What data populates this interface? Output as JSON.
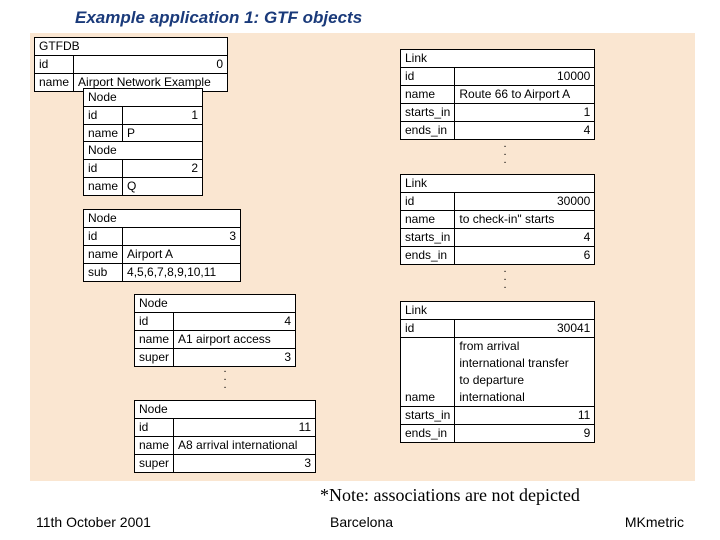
{
  "title": "Example application 1: GTF objects",
  "note": "*Note: associations are not depicted",
  "footer": {
    "left": "11th October 2001",
    "center": "Barcelona",
    "right": "MKmetric"
  },
  "labels": {
    "gtfdb": "GTFDB",
    "id": "id",
    "name": "name",
    "node": "Node",
    "sub": "sub",
    "super": "super",
    "link": "Link",
    "starts_in": "starts_in",
    "ends_in": "ends_in"
  },
  "gtfdb": {
    "id": "0",
    "name": "Airport Network Example"
  },
  "nodes": {
    "n1": {
      "id": "1",
      "name": "P"
    },
    "n2": {
      "id": "2",
      "name": "Q"
    },
    "n3": {
      "id": "3",
      "name": "Airport A",
      "sub": "4,5,6,7,8,9,10,11"
    },
    "n4": {
      "id": "4",
      "name": "A1 airport access",
      "super": "3"
    },
    "n11": {
      "id": "11",
      "name": "A8 arrival international",
      "super": "3"
    }
  },
  "links": {
    "l1": {
      "id": "10000",
      "name": "Route 66 to Airport A",
      "starts": "1",
      "ends": "4"
    },
    "l2": {
      "id": "30000",
      "name": "to check-in\" starts",
      "starts": "4",
      "ends": "6"
    },
    "l3": {
      "id": "30041",
      "name_line1": "from arrival",
      "name_line2": "international transfer",
      "name_line3": "to departure",
      "name_line4": "international",
      "starts": "11",
      "ends": "9"
    }
  }
}
